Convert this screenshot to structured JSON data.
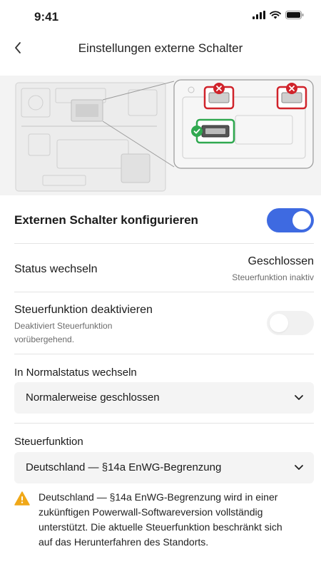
{
  "status_bar": {
    "time": "9:41"
  },
  "nav": {
    "title": "Einstellungen externe Schalter"
  },
  "config": {
    "label": "Externen Schalter konfigurieren",
    "enabled": true
  },
  "status_change": {
    "label": "Status wechseln",
    "value": "Geschlossen",
    "note": "Steuerfunktion inaktiv"
  },
  "deactivate": {
    "label": "Steuerfunktion deaktivieren",
    "description": "Deaktiviert Steuerfunktion vorübergehend.",
    "enabled": false
  },
  "normal_state": {
    "label": "In Normalstatus wechseln",
    "selected": "Normalerweise geschlossen"
  },
  "control_function": {
    "label": "Steuerfunktion",
    "selected": "Deutschland — §14a EnWG-Begrenzung"
  },
  "warning": {
    "text": "Deutschland — §14a EnWG-Begrenzung wird in einer zukünftigen Powerwall-Softwareversion vollständig unterstützt. Die aktuelle Steuerfunktion beschränkt sich auf das Herunterfahren des Standorts."
  },
  "colors": {
    "accent": "#3e6ae1",
    "error": "#d0232b",
    "success": "#2fa84f",
    "warning": "#f0a818"
  },
  "icons": [
    "back-chevron-icon",
    "signal-icon",
    "wifi-icon",
    "battery-icon",
    "error-x-icon",
    "check-icon",
    "chevron-down-icon",
    "warning-icon"
  ]
}
